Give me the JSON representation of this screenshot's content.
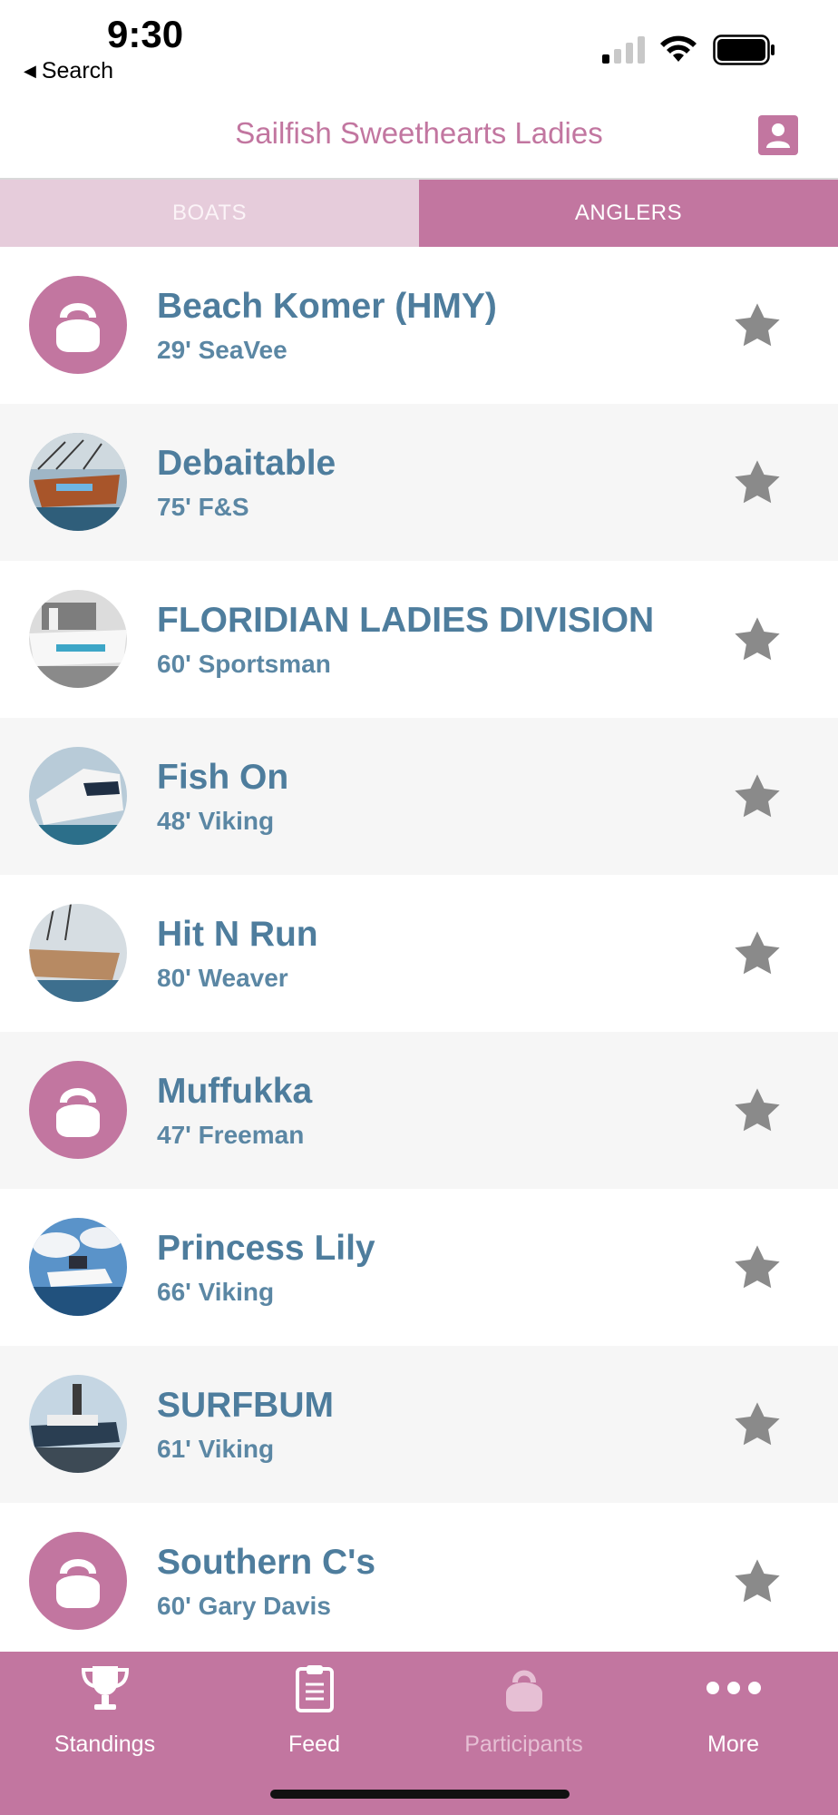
{
  "status": {
    "time": "9:30",
    "back_label": "Search"
  },
  "nav": {
    "title": "Sailfish Sweethearts Ladies"
  },
  "segments": [
    {
      "label": "BOATS",
      "selected": false
    },
    {
      "label": "ANGLERS",
      "selected": true
    }
  ],
  "boats": [
    {
      "name": "Beach Komer (HMY)",
      "desc": "29' SeaVee",
      "avatar": "kettlebell-placeholder"
    },
    {
      "name": "Debaitable",
      "desc": "75' F&S",
      "avatar": "boat-photo"
    },
    {
      "name": "FLORIDIAN LADIES DIVISION",
      "desc": "60' Sportsman",
      "avatar": "boat-photo"
    },
    {
      "name": "Fish On",
      "desc": "48' Viking",
      "avatar": "boat-photo"
    },
    {
      "name": "Hit N Run",
      "desc": "80' Weaver",
      "avatar": "boat-photo"
    },
    {
      "name": "Muffukka",
      "desc": "47' Freeman",
      "avatar": "kettlebell-placeholder"
    },
    {
      "name": "Princess Lily",
      "desc": "66' Viking",
      "avatar": "boat-photo"
    },
    {
      "name": "SURFBUM",
      "desc": "61' Viking",
      "avatar": "boat-photo"
    },
    {
      "name": "Southern C's",
      "desc": "60' Gary Davis",
      "avatar": "kettlebell-placeholder"
    }
  ],
  "tabs": [
    {
      "label": "Standings",
      "icon": "trophy-icon",
      "active": false
    },
    {
      "label": "Feed",
      "icon": "clipboard-icon",
      "active": false
    },
    {
      "label": "Participants",
      "icon": "kettlebell-icon",
      "active": true
    },
    {
      "label": "More",
      "icon": "more-dots-icon",
      "active": false
    }
  ],
  "colors": {
    "accent": "#c276a0",
    "accent_light": "#e6ccdb",
    "boat_text": "#4e7d9d",
    "star": "#8a8a8a",
    "row_alt": "#f6f6f6"
  }
}
